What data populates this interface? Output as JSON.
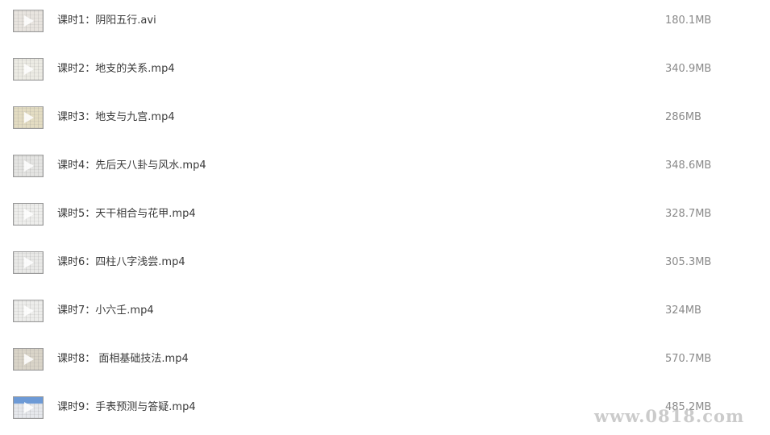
{
  "files": [
    {
      "name": "课时1：阴阳五行.avi",
      "size": "180.1MB",
      "thumb_icon": "video-thumbnail-icon",
      "thumb_color": "#e8e4df"
    },
    {
      "name": "课时2：地支的关系.mp4",
      "size": "340.9MB",
      "thumb_icon": "video-thumbnail-icon",
      "thumb_color": "#ecebe4"
    },
    {
      "name": "课时3：地支与九宫.mp4",
      "size": "286MB",
      "thumb_icon": "video-thumbnail-icon",
      "thumb_color": "#e3dcc2"
    },
    {
      "name": "课时4：先后天八卦与风水.mp4",
      "size": "348.6MB",
      "thumb_icon": "video-thumbnail-icon",
      "thumb_color": "#e4e4e2"
    },
    {
      "name": "课时5：天干相合与花甲.mp4",
      "size": "328.7MB",
      "thumb_icon": "video-thumbnail-icon",
      "thumb_color": "#eeeeec"
    },
    {
      "name": "课时6：四柱八字浅尝.mp4",
      "size": "305.3MB",
      "thumb_icon": "video-thumbnail-icon",
      "thumb_color": "#e9e9e7"
    },
    {
      "name": "课时7：小六壬.mp4",
      "size": "324MB",
      "thumb_icon": "video-thumbnail-icon",
      "thumb_color": "#ededeb"
    },
    {
      "name": "课时8： 面相基础技法.mp4",
      "size": "570.7MB",
      "thumb_icon": "video-thumbnail-icon",
      "thumb_color": "#d9d4c8"
    },
    {
      "name": "课时9：手表预测与答疑.mp4",
      "size": "485.2MB",
      "thumb_icon": "video-thumbnail-icon",
      "thumb_color": "#e6e8ec",
      "thumb_band_color": "#6d9ad6"
    }
  ],
  "watermark": "www.0818.com"
}
